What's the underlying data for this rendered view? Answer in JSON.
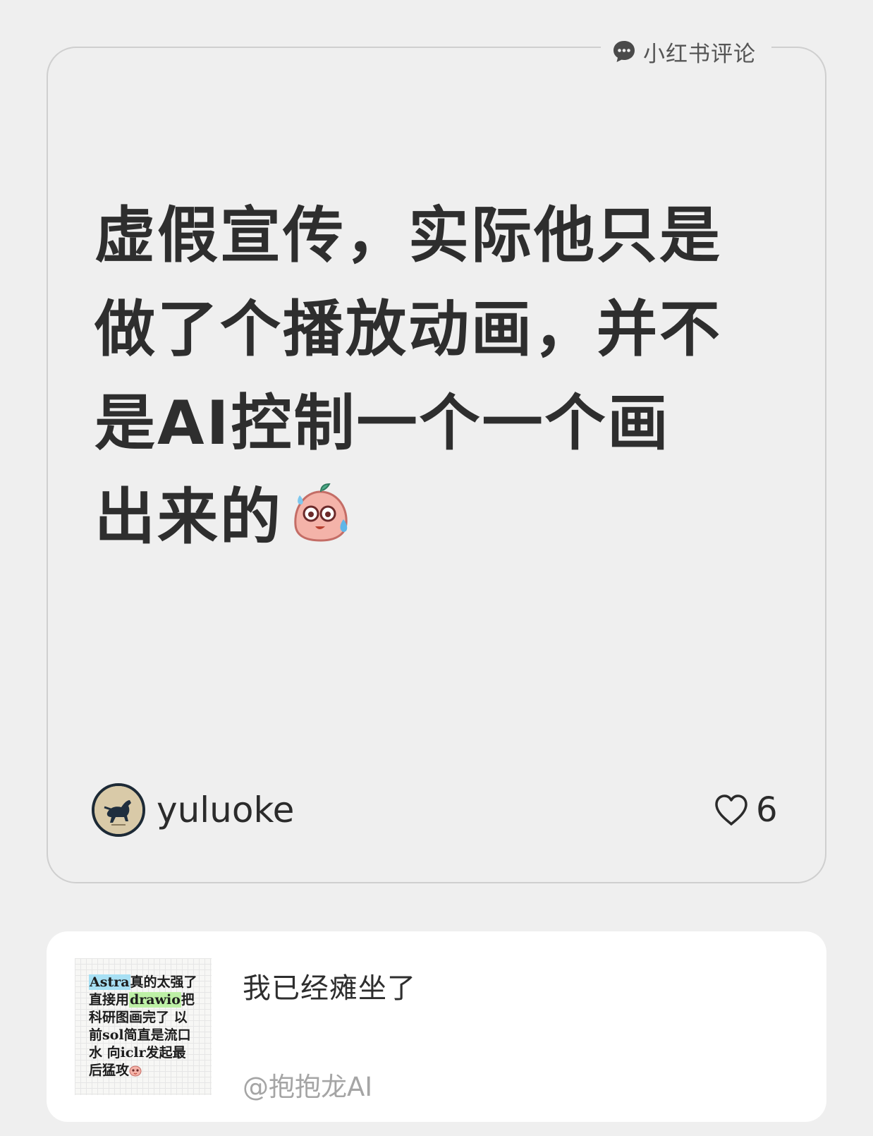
{
  "source": {
    "label": "小红书评论",
    "icon": "chat-bubble-icon"
  },
  "comment": {
    "lines": [
      "虚假宣传，实际他只是",
      "做了个播放动画，并不",
      "是AI控制一个一个画",
      "出来的"
    ],
    "emoji": "sweating-face-emoji",
    "author": "yuluoke",
    "likes": "6"
  },
  "post": {
    "thumbnail": {
      "line1_highlight": "Astra",
      "line1_rest": "真的太强了",
      "line2_start": "直接用",
      "line2_highlight": "drawio",
      "line2_end": "把",
      "line3": "科研图画完了 以",
      "line4": "前sol简直是流口",
      "line5": "水 向iclr发起最",
      "line6": "后猛攻"
    },
    "title": "我已经瘫坐了",
    "author": "@抱抱龙AI"
  },
  "colors": {
    "background": "#efefef",
    "card_border": "#cfcfcf",
    "highlight_blue": "#a8e0f4",
    "highlight_green": "#bdf0a6"
  }
}
